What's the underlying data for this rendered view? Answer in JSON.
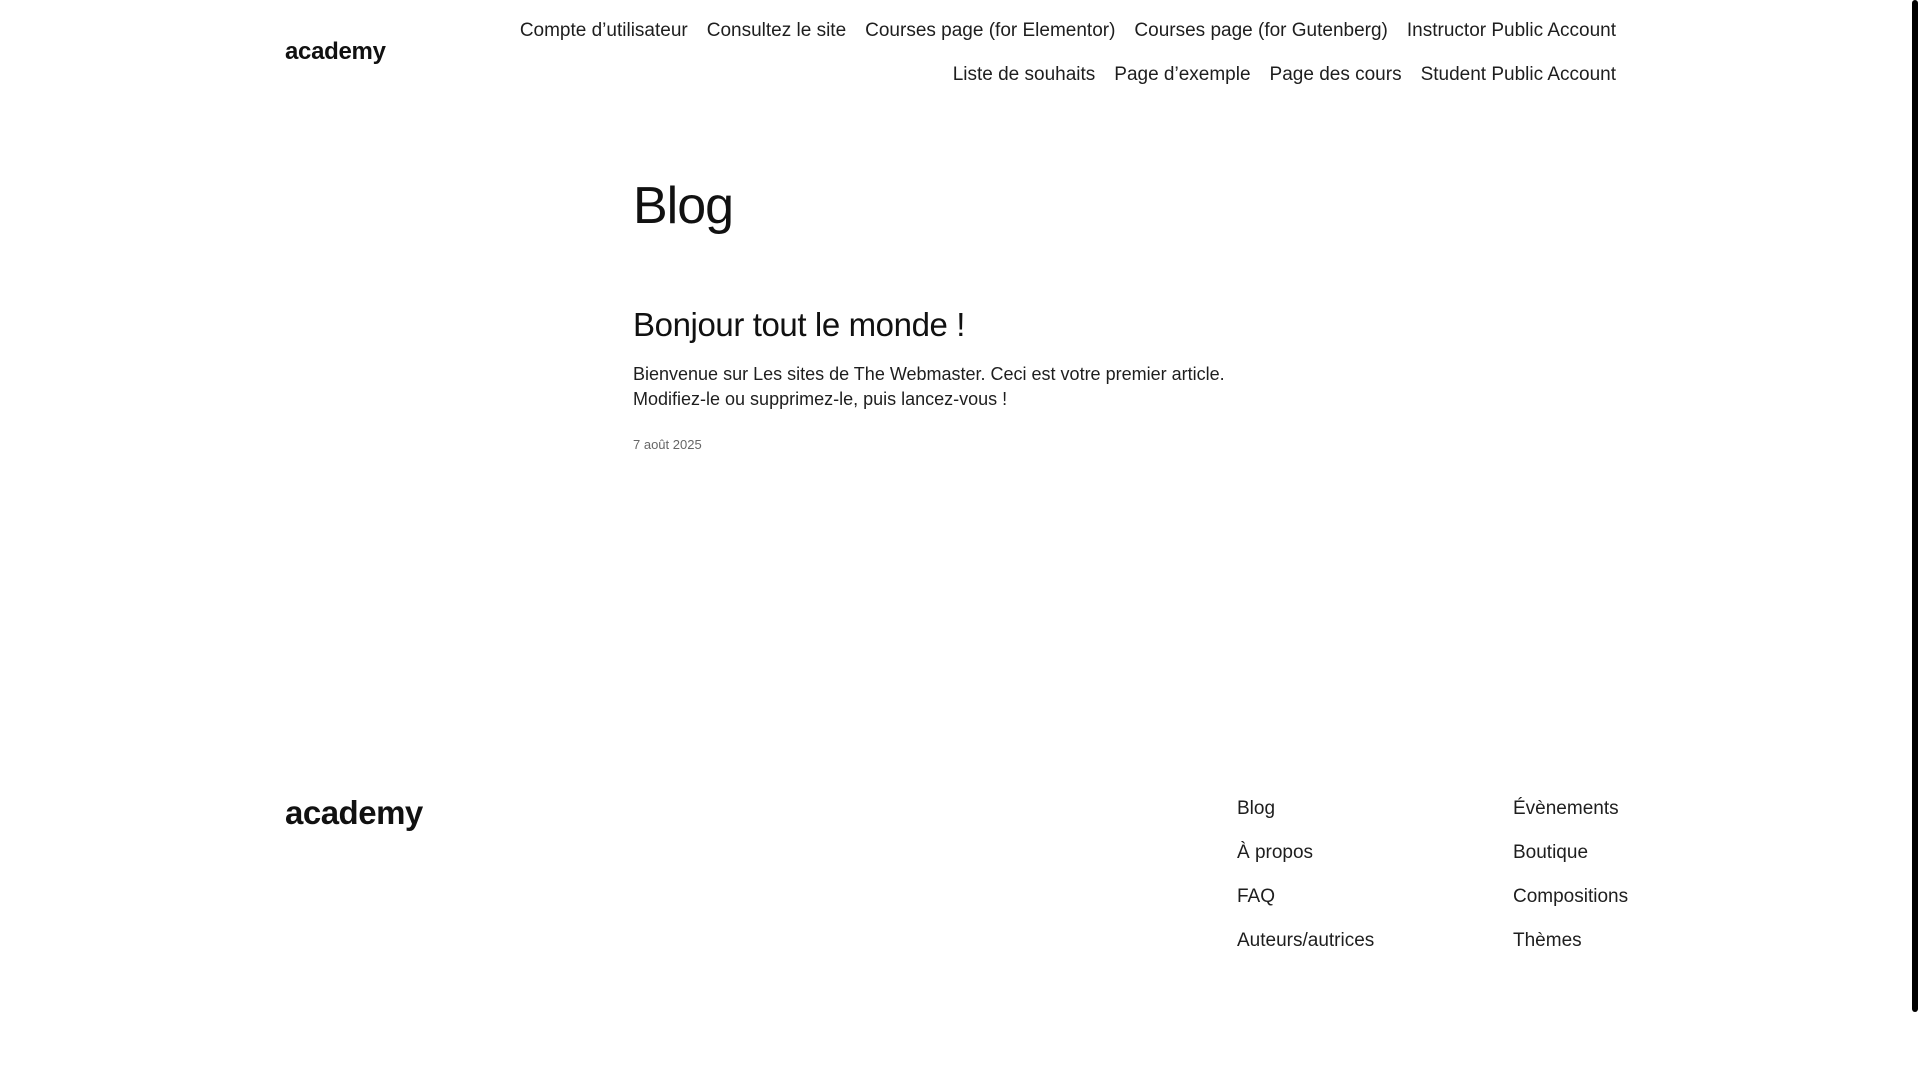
{
  "header": {
    "site_title": "academy",
    "nav": {
      "row1": [
        "Compte d’utilisateur",
        "Consultez le site",
        "Courses page (for Elementor)",
        "Courses page (for Gutenberg)",
        "Instructor Public Account"
      ],
      "row2": [
        "Liste de souhaits",
        "Page d’exemple",
        "Page des cours",
        "Student Public Account"
      ]
    }
  },
  "main": {
    "page_title": "Blog",
    "post": {
      "title": "Bonjour tout le monde !",
      "excerpt_line1": "Bienvenue sur Les sites de The Webmaster. Ceci est votre premier article.",
      "excerpt_line2": "Modifiez-le ou supprimez-le, puis lancez-vous !",
      "date": "7 août 2025"
    }
  },
  "footer": {
    "site_title": "academy",
    "col1": [
      "Blog",
      "À propos",
      "FAQ",
      "Auteurs/autrices"
    ],
    "col2": [
      "Évènements",
      "Boutique",
      "Compositions",
      "Thèmes"
    ]
  }
}
